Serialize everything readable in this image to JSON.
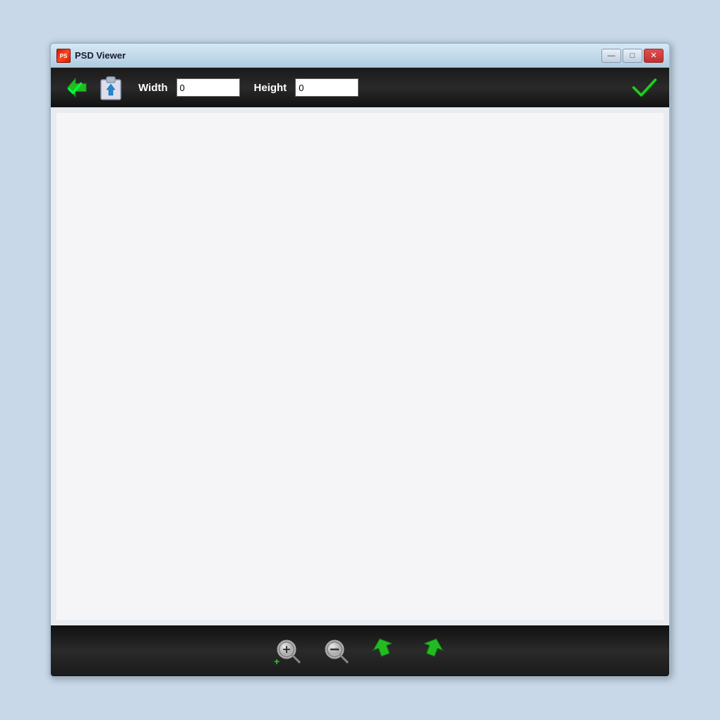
{
  "window": {
    "title": "PSD Viewer",
    "icon": "🔷"
  },
  "titlebar": {
    "minimize_label": "—",
    "restore_label": "□",
    "close_label": "✕"
  },
  "toolbar": {
    "width_label": "Width",
    "height_label": "Height",
    "width_value": "0",
    "height_value": "0",
    "width_placeholder": "",
    "height_placeholder": ""
  },
  "bottom_toolbar": {
    "zoom_in_label": "zoom-in",
    "zoom_out_label": "zoom-out",
    "rotate_left_label": "rotate-left",
    "rotate_right_label": "rotate-right"
  },
  "colors": {
    "toolbar_bg": "#111111",
    "green_check": "#22cc22",
    "close_btn": "#cc3333",
    "title_bg_start": "#d6e8f5",
    "title_bg_end": "#b0cce0"
  }
}
